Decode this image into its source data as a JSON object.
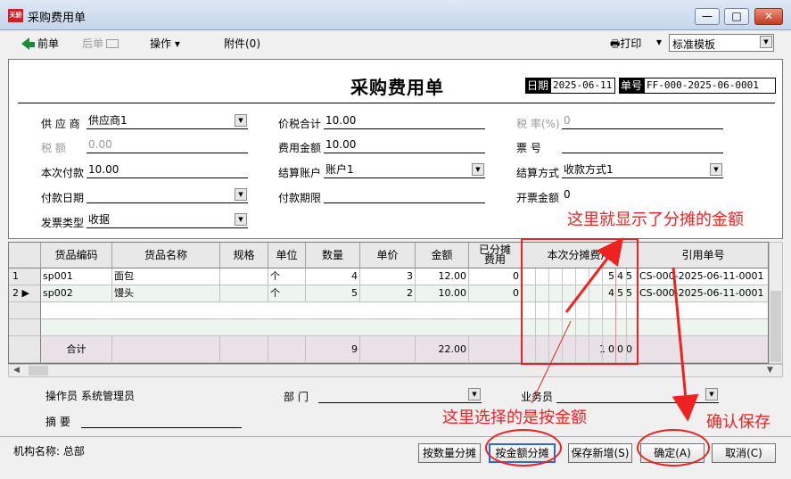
{
  "window": {
    "title": "采购费用单",
    "app_icon_text": "天骄",
    "min_label": "—",
    "max_label": "□",
    "close_label": "✕"
  },
  "toolbar": {
    "prev": "前单",
    "next": "后单",
    "operate": "操作",
    "attachment": "附件(0)",
    "print": "打印",
    "template": "标准模板"
  },
  "header": {
    "title": "采购费用单",
    "date_label": "日期",
    "date_value": "2025-06-11",
    "no_label": "单号",
    "no_value": "FF-000-2025-06-0001"
  },
  "fields": {
    "supplier_label": "供 应 商",
    "supplier_value": "供应商1",
    "tax_total_label": "价税合计",
    "tax_total_value": "10.00",
    "tax_rate_label": "税 率(%)",
    "tax_rate_value": "0",
    "tax_label": "税 额",
    "tax_value": "0.00",
    "fee_amount_label": "费用金额",
    "fee_amount_value": "10.00",
    "invoice_no_label": "票 号",
    "invoice_no_value": "",
    "pay_now_label": "本次付款",
    "pay_now_value": "10.00",
    "account_label": "结算账户",
    "account_value": "账户1",
    "settle_method_label": "结算方式",
    "settle_method_value": "收款方式1",
    "pay_date_label": "付款日期",
    "pay_date_value": "",
    "pay_term_label": "付款期限",
    "pay_term_value": "",
    "invoiced_amount_label": "开票金额",
    "invoiced_amount_value": "0",
    "invoice_type_label": "发票类型",
    "invoice_type_value": "收据"
  },
  "grid": {
    "columns": [
      "货品编码",
      "货品名称",
      "规格",
      "单位",
      "数量",
      "单价",
      "金额",
      "已分摊费用",
      "本次分摊费用",
      "引用单号"
    ],
    "rows": [
      {
        "idx": "1",
        "code": "sp001",
        "name": "面包",
        "spec": "",
        "unit": "个",
        "qty": "4",
        "price": "3",
        "amount": "12.00",
        "allocated": "0",
        "this_alloc": "545",
        "ref": "CS-000-2025-06-11-0001"
      },
      {
        "idx": "2",
        "code": "sp002",
        "name": "馒头",
        "spec": "",
        "unit": "个",
        "qty": "5",
        "price": "2",
        "amount": "10.00",
        "allocated": "0",
        "this_alloc": "455",
        "ref": "CS-000-2025-06-11-0001"
      }
    ],
    "summary": {
      "label": "合计",
      "qty": "9",
      "amount": "22.00",
      "this_alloc": "1000"
    }
  },
  "bottom": {
    "operator_label": "操作员",
    "operator_value": "系统管理员",
    "dept_label": "部 门",
    "dept_value": "",
    "sales_label": "业务员",
    "sales_value": "",
    "memo_label": "摘 要",
    "memo_value": ""
  },
  "footer": {
    "org": "机构名称: 总部"
  },
  "buttons": {
    "by_qty": "按数量分摊",
    "by_amount": "按金额分摊",
    "save_new": "保存新增(S)",
    "ok": "确定(A)",
    "cancel": "取消(C)"
  },
  "annotations": {
    "shows_amount": "这里就显示了分摊的金额",
    "select_by_amount": "这里选择的是按金额",
    "confirm_save": "确认保存"
  },
  "colors": {
    "annotation": "#ee2222",
    "focus_border": "#2a6bd8"
  }
}
